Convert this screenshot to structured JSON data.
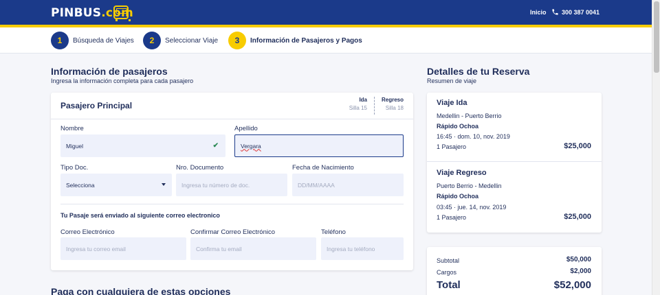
{
  "header": {
    "logo_main": "PINBUS",
    "logo_suffix": ".com",
    "nav_inicio": "Inicio",
    "phone": "300 387 0041"
  },
  "steps": [
    {
      "number": "1",
      "label": "Búsqueda de Viajes",
      "state": "done"
    },
    {
      "number": "2",
      "label": "Seleccionar Viaje",
      "state": "done"
    },
    {
      "number": "3",
      "label": "Información de Pasajeros y Pagos",
      "state": "active"
    }
  ],
  "passengers": {
    "title": "Información de pasajeros",
    "subtitle": "Ingresa la información completa para cada pasajero",
    "card_title": "Pasajero Principal",
    "ida_label": "Ida",
    "ida_seat": "Silla 15",
    "regreso_label": "Regreso",
    "regreso_seat": "Silla 18",
    "nombre_label": "Nombre",
    "nombre_value": "Miguel",
    "apellido_label": "Apellido",
    "apellido_value": "Vergara",
    "tipo_doc_label": "Tipo Doc.",
    "tipo_doc_value": "Selecciona",
    "nro_doc_label": "Nro. Documento",
    "nro_doc_placeholder": "Ingresa tu número de doc.",
    "fecha_label": "Fecha de Nacimiento",
    "fecha_placeholder": "DD/MM/AAAA",
    "email_note": "Tu Pasaje será enviado al siguiente correo electronico",
    "correo_label": "Correo Electrónico",
    "correo_placeholder": "Ingresa tu correo email",
    "confirmar_label": "Confirmar Correo Electrónico",
    "confirmar_placeholder": "Confirma tu email",
    "telefono_label": "Teléfono",
    "telefono_placeholder": "Ingresa tu teléfono"
  },
  "payment": {
    "title": "Paga con cualquiera de estas opciones"
  },
  "reservation": {
    "title": "Detalles de tu Reserva",
    "subtitle": "Resumen de viaje",
    "ida": {
      "heading": "Viaje Ida",
      "route": "Medellin - Puerto Berrio",
      "company": "Rápido Ochoa",
      "datetime": "16:45 · dom. 10, nov. 2019",
      "passengers": "1 Pasajero",
      "price": "$25,000"
    },
    "regreso": {
      "heading": "Viaje Regreso",
      "route": "Puerto Berrio - Medellin",
      "company": "Rápido Ochoa",
      "datetime": "03:45 · jue. 14, nov. 2019",
      "passengers": "1 Pasajero",
      "price": "$25,000"
    }
  },
  "totals": {
    "subtotal_label": "Subtotal",
    "subtotal_value": "$50,000",
    "cargos_label": "Cargos",
    "cargos_value": "$2,000",
    "total_label": "Total",
    "total_value": "$52,000"
  },
  "colors": {
    "brand_blue": "#1b3a8a",
    "brand_yellow": "#f8cc00",
    "field_bg": "#eef1fb"
  }
}
